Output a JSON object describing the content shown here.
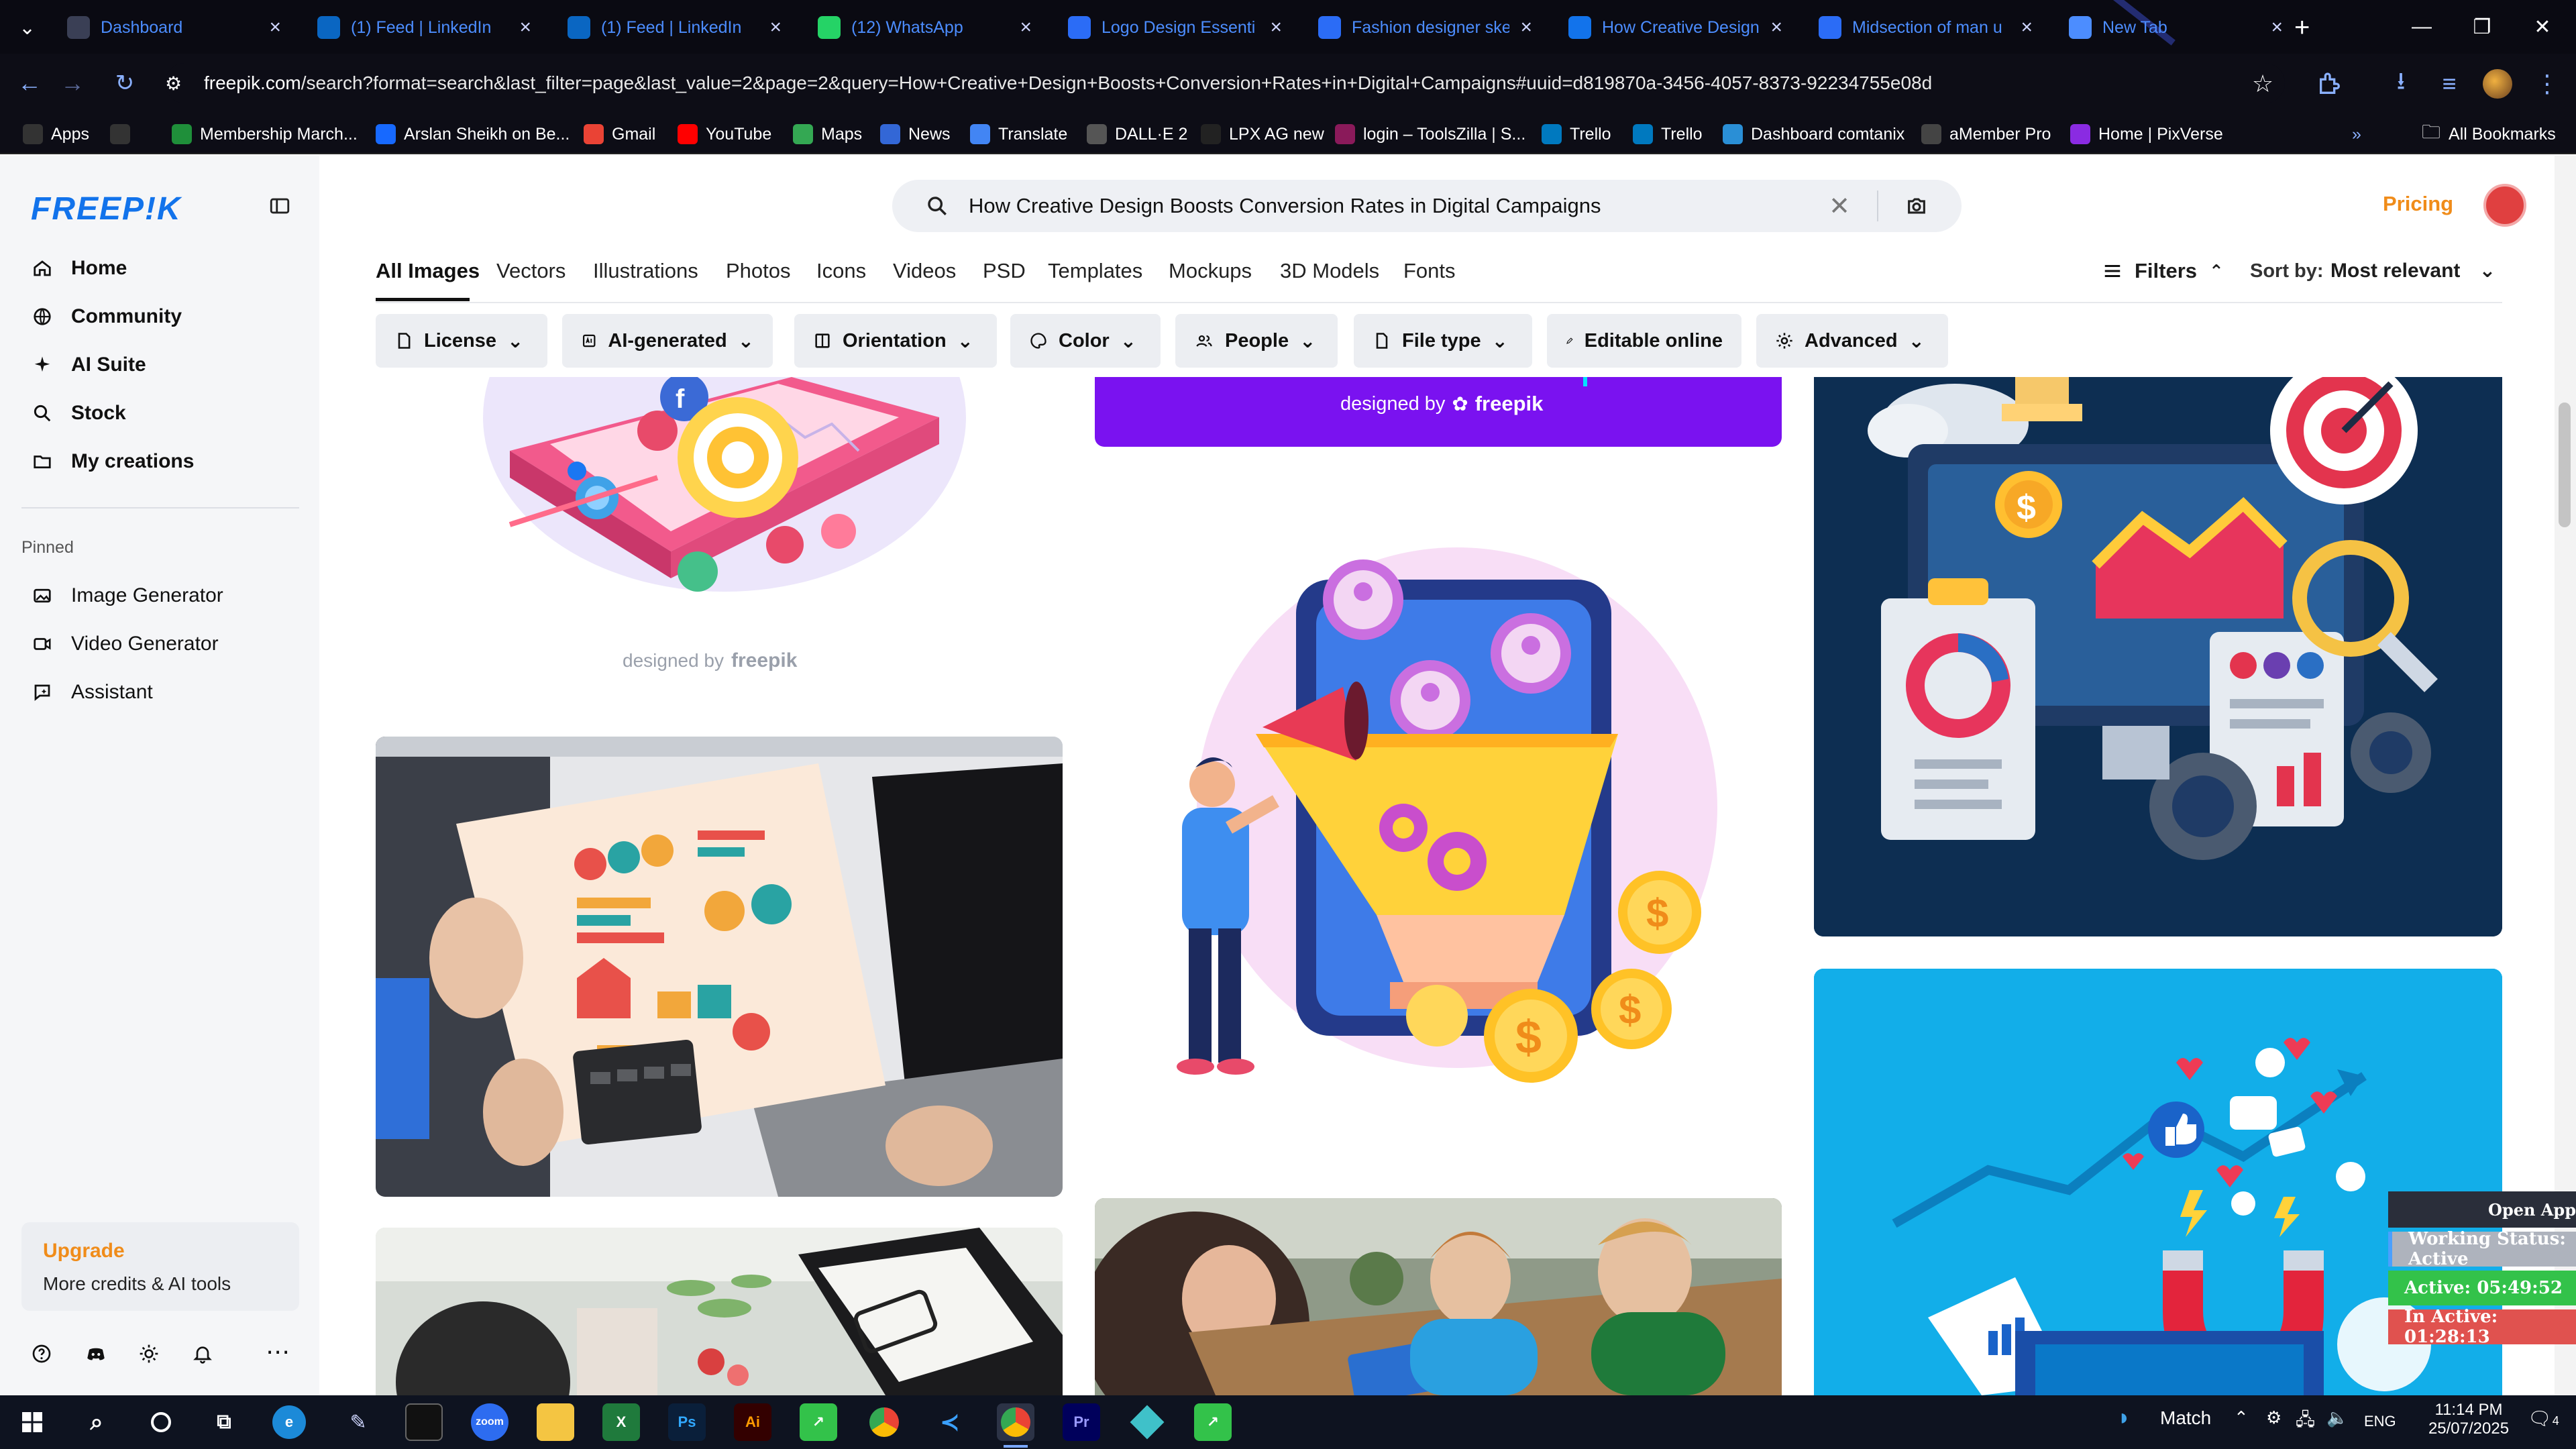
{
  "browser": {
    "tabs": [
      {
        "label": "Dashboard",
        "icon": "dashboard-favicon",
        "color": "#3a3f55"
      },
      {
        "label": "(1) Feed | LinkedIn",
        "icon": "linkedin-favicon",
        "color": "#0a66c2"
      },
      {
        "label": "(1) Feed | LinkedIn",
        "icon": "linkedin-favicon",
        "color": "#0a66c2"
      },
      {
        "label": "(12) WhatsApp",
        "icon": "whatsapp-favicon",
        "color": "#25d366"
      },
      {
        "label": "Logo Design Essenti",
        "icon": "doc-favicon",
        "color": "#2b6cf6"
      },
      {
        "label": "Fashion designer ske",
        "icon": "doc-favicon",
        "color": "#2b6cf6"
      },
      {
        "label": "How Creative Design",
        "icon": "freepik-favicon",
        "color": "#1273eb"
      },
      {
        "label": "Midsection of man u",
        "icon": "doc-favicon",
        "color": "#2b6cf6"
      },
      {
        "label": "New Tab",
        "icon": "chrome-favicon",
        "color": "#4c8dff"
      }
    ],
    "url_site": "freepik.com",
    "url_path": "/search?format=search&last_filter=page&last_value=2&page=2&query=How+Creative+Design+Boosts+Conversion+Rates+in+Digital+Campaigns#uuid=d819870a-3456-4057-8373-92234755e08d",
    "bookmarks": [
      {
        "label": "Apps",
        "icon": "apps-grid-icon"
      },
      {
        "label": "",
        "icon": "grid-icon"
      },
      {
        "label": "Membership March...",
        "icon": "membership-icon"
      },
      {
        "label": "Arslan Sheikh on Be...",
        "icon": "behance-icon"
      },
      {
        "label": "Gmail",
        "icon": "gmail-icon"
      },
      {
        "label": "YouTube",
        "icon": "youtube-icon"
      },
      {
        "label": "Maps",
        "icon": "maps-icon"
      },
      {
        "label": "News",
        "icon": "news-icon"
      },
      {
        "label": "Translate",
        "icon": "translate-icon"
      },
      {
        "label": "DALL·E 2",
        "icon": "openai-icon"
      },
      {
        "label": "LPX AG new",
        "icon": "lpx-icon"
      },
      {
        "label": "login – ToolsZilla | S...",
        "icon": "toolszilla-icon"
      },
      {
        "label": "Trello",
        "icon": "trello-icon"
      },
      {
        "label": "Trello",
        "icon": "trello-icon"
      },
      {
        "label": "Dashboard comtanix",
        "icon": "comtanix-icon"
      },
      {
        "label": "aMember Pro",
        "icon": "amember-icon"
      },
      {
        "label": "Home | PixVerse",
        "icon": "pixverse-icon"
      }
    ],
    "all_bookmarks": "All Bookmarks"
  },
  "sidebar": {
    "logo": "FREEP!K",
    "nav": [
      {
        "label": "Home",
        "icon": "home-icon"
      },
      {
        "label": "Community",
        "icon": "globe-icon"
      },
      {
        "label": "AI Suite",
        "icon": "sparkle-icon"
      },
      {
        "label": "Stock",
        "icon": "search-icon"
      },
      {
        "label": "My creations",
        "icon": "folder-icon"
      }
    ],
    "pinned_title": "Pinned",
    "pinned": [
      {
        "label": "Image Generator",
        "icon": "image-icon"
      },
      {
        "label": "Video Generator",
        "icon": "video-icon"
      },
      {
        "label": "Assistant",
        "icon": "assistant-icon"
      }
    ],
    "upgrade_title": "Upgrade",
    "upgrade_sub": "More credits & AI tools"
  },
  "header": {
    "search_query": "How Creative Design Boosts Conversion Rates in Digital Campaigns",
    "pricing": "Pricing"
  },
  "filters": {
    "types": [
      "All Images",
      "Vectors",
      "Illustrations",
      "Photos",
      "Icons",
      "Videos",
      "PSD",
      "Templates",
      "Mockups",
      "3D Models",
      "Fonts"
    ],
    "filters_label": "Filters",
    "sort_label": "Sort by:",
    "sort_value": "Most relevant",
    "chips": [
      "License",
      "AI-generated",
      "Orientation",
      "Color",
      "People",
      "File type",
      "Editable online",
      "Advanced"
    ]
  },
  "results": {
    "watermark_designed_by": "designed by",
    "watermark_brand": "freepik"
  },
  "widget": {
    "open_app": "Open App",
    "working_status": "Working Status: Active",
    "active": "Active: 05:49:52",
    "inactive": "In Active: 01:28:13"
  },
  "taskbar": {
    "weather": "Match",
    "lang": "ENG",
    "time": "11:14 PM",
    "date": "25/07/2025",
    "notifications": "4"
  },
  "colors": {
    "brand_blue": "#1273eb",
    "pricing_orange": "#f08c1a",
    "upgrade_orange": "#f08c1a",
    "purple_banner": "#7a12f0"
  }
}
